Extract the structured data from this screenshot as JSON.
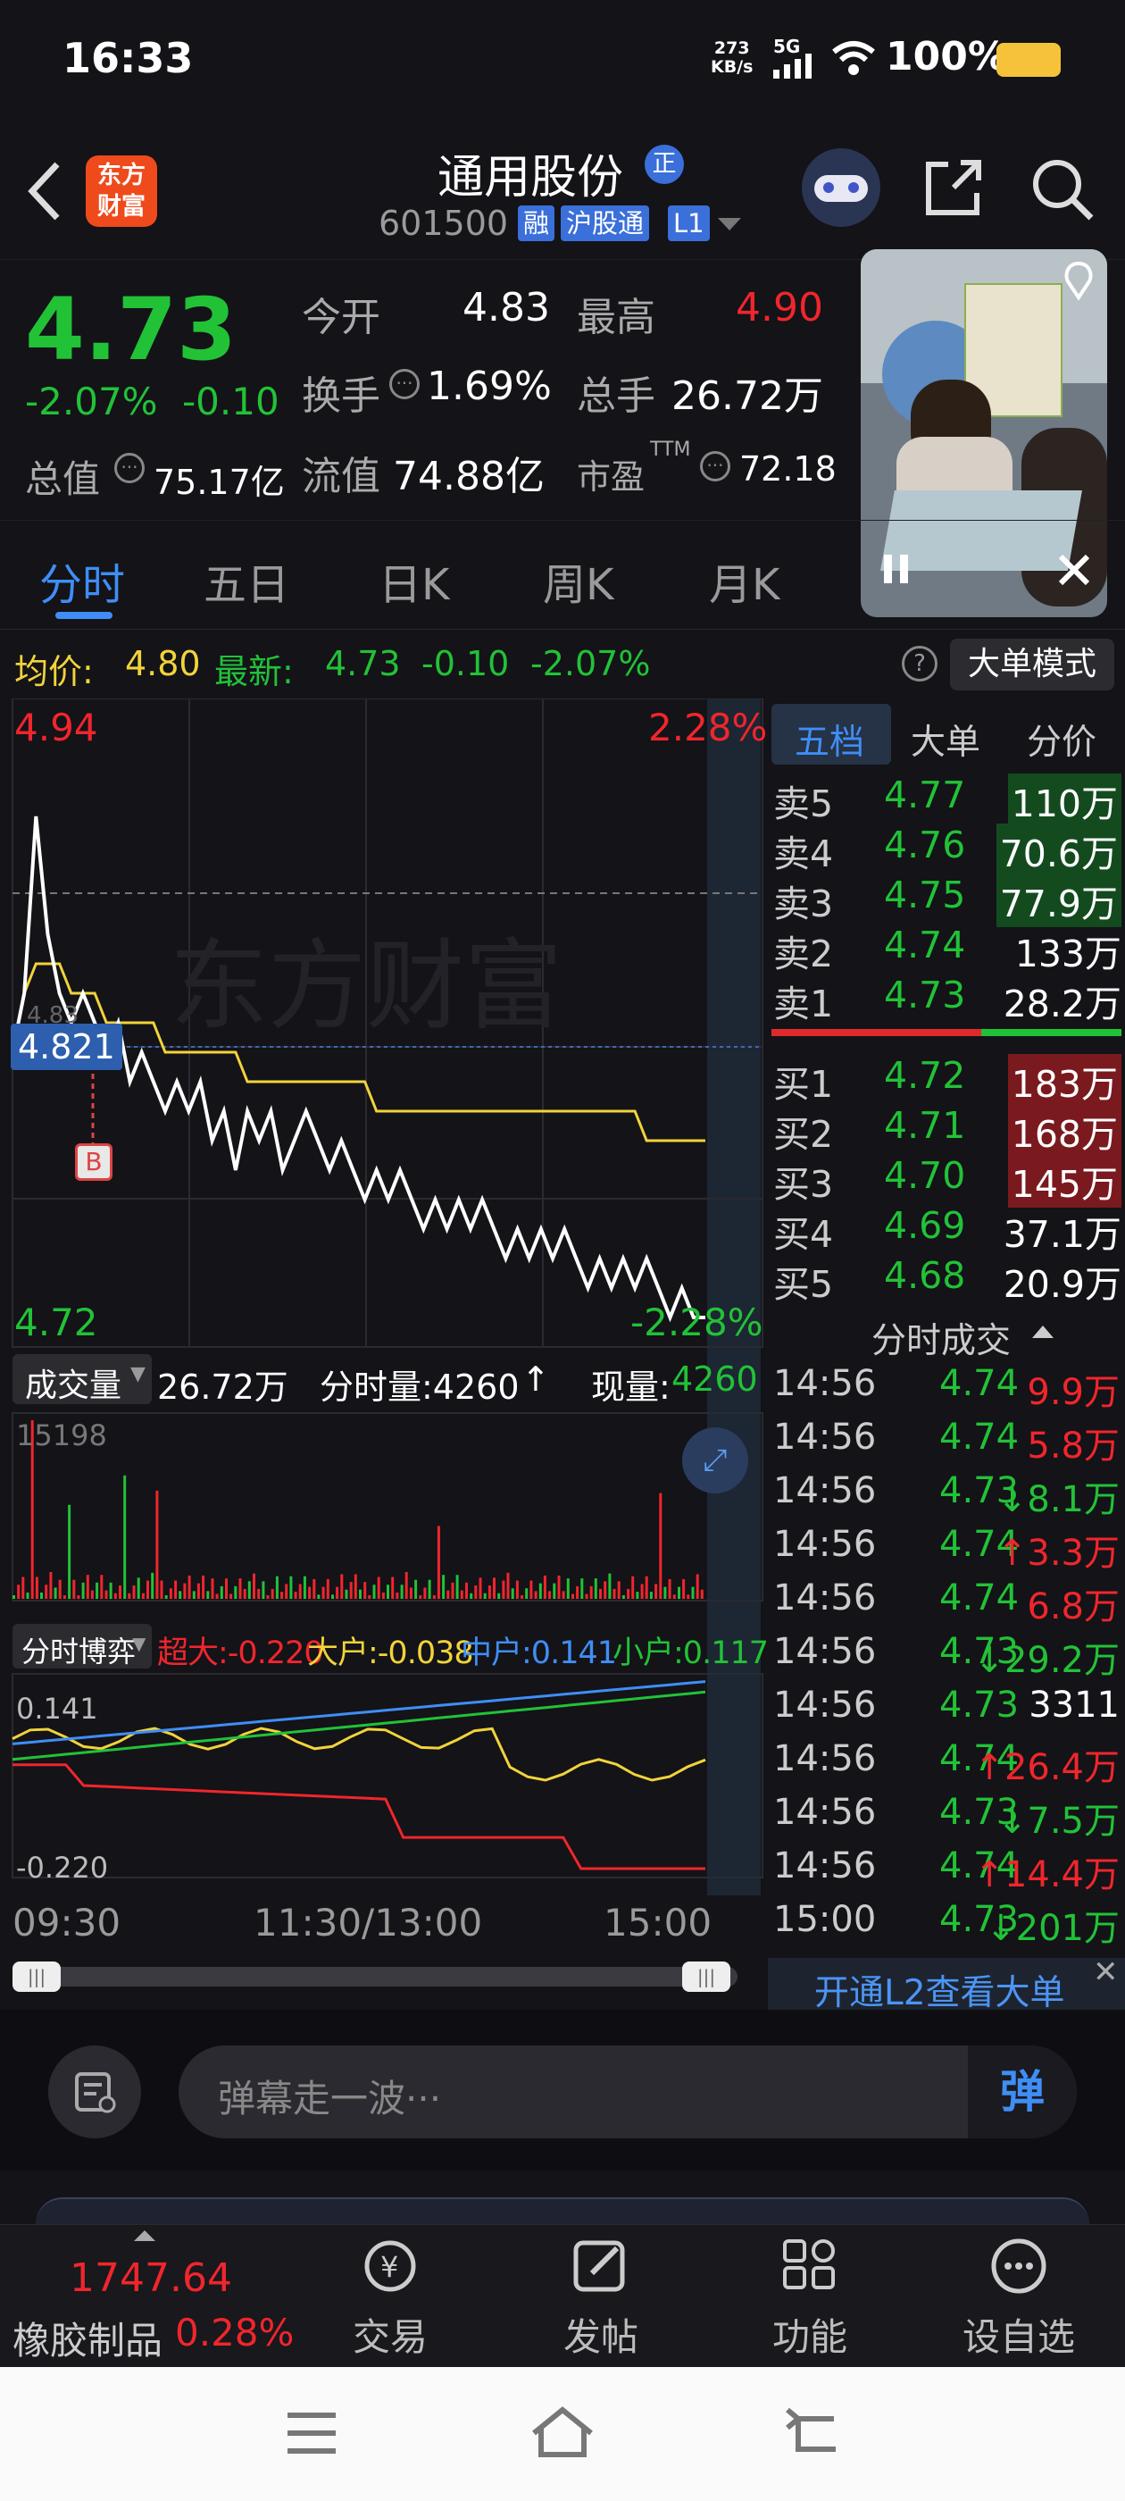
{
  "status": {
    "time": "16:33",
    "net_speed_top": "273",
    "net_speed_bottom": "KB/s",
    "network": "5G",
    "battery": "100%"
  },
  "header": {
    "logo_top": "东方",
    "logo_bottom": "财富",
    "stock_name": "通用股份",
    "badge_zheng": "正",
    "code": "601500",
    "tag_rong": "融",
    "tag_hgt": "沪股通",
    "tag_l1": "L1"
  },
  "quote": {
    "price": "4.73",
    "change_pct": "-2.07%",
    "change": "-0.10",
    "open_label": "今开",
    "open": "4.83",
    "high_label": "最高",
    "high": "4.90",
    "turnover_label": "换手",
    "turnover": "1.69%",
    "volume_label": "总手",
    "volume": "26.72万",
    "mktcap_label": "总值",
    "mktcap": "75.17亿",
    "float_label": "流值",
    "float_cap": "74.88亿",
    "pe_label": "市盈",
    "pe_sup": "TTM",
    "pe": "72.18"
  },
  "tabs": [
    "分时",
    "五日",
    "日K",
    "周K",
    "月K"
  ],
  "avg_row": {
    "avg_label": "均价:",
    "avg": "4.80",
    "latest_label": "最新:",
    "latest": "4.73",
    "chg": "-0.10",
    "pct": "-2.07%",
    "mode_button": "大单模式"
  },
  "chart": {
    "top_price": "4.94",
    "top_pct": "2.28%",
    "bottom_price": "4.72",
    "bottom_pct": "-2.28%",
    "cursor_price": "4.821",
    "marker": "B",
    "watermark": "东方财富",
    "mid_label": "4.83"
  },
  "volume_bar": {
    "label": "成交量",
    "total": "26.72万",
    "fen_label": "分时量:4260",
    "arrow": "↑",
    "now_label": "现量:",
    "now": "4260",
    "max": "15198"
  },
  "game": {
    "label": "分时博弈",
    "super_label": "超大:",
    "super": "-0.220",
    "big_label": "大户:",
    "big": "-0.038",
    "mid_label": "中户:",
    "mid": "0.141",
    "small_label": "小户:",
    "small": "0.117",
    "max": "0.141",
    "min": "-0.220"
  },
  "time_axis": [
    "09:30",
    "11:30/13:00",
    "15:00"
  ],
  "book": {
    "tabs": [
      "五档",
      "大单",
      "分价"
    ],
    "asks": [
      {
        "label": "卖5",
        "price": "4.77",
        "vol": "110万"
      },
      {
        "label": "卖4",
        "price": "4.76",
        "vol": "70.6万"
      },
      {
        "label": "卖3",
        "price": "4.75",
        "vol": "77.9万"
      },
      {
        "label": "卖2",
        "price": "4.74",
        "vol": "133万"
      },
      {
        "label": "卖1",
        "price": "4.73",
        "vol": "28.2万"
      }
    ],
    "bids": [
      {
        "label": "买1",
        "price": "4.72",
        "vol": "183万"
      },
      {
        "label": "买2",
        "price": "4.71",
        "vol": "168万"
      },
      {
        "label": "买3",
        "price": "4.70",
        "vol": "145万"
      },
      {
        "label": "买4",
        "price": "4.69",
        "vol": "37.1万"
      },
      {
        "label": "买5",
        "price": "4.68",
        "vol": "20.9万"
      }
    ],
    "trades_title": "分时成交",
    "trades": [
      {
        "t": "14:56",
        "p": "4.74",
        "v": "9.9万",
        "c": "red",
        "a": ""
      },
      {
        "t": "14:56",
        "p": "4.74",
        "v": "5.8万",
        "c": "red",
        "a": ""
      },
      {
        "t": "14:56",
        "p": "4.73",
        "v": "8.1万",
        "c": "green",
        "a": "↓"
      },
      {
        "t": "14:56",
        "p": "4.74",
        "v": "3.3万",
        "c": "red",
        "a": "↑"
      },
      {
        "t": "14:56",
        "p": "4.74",
        "v": "6.8万",
        "c": "red",
        "a": ""
      },
      {
        "t": "14:56",
        "p": "4.73",
        "v": "29.2万",
        "c": "green",
        "a": "↓"
      },
      {
        "t": "14:56",
        "p": "4.73",
        "v": "3311",
        "c": "white",
        "a": ""
      },
      {
        "t": "14:56",
        "p": "4.74",
        "v": "26.4万",
        "c": "red",
        "a": "↑"
      },
      {
        "t": "14:56",
        "p": "4.73",
        "v": "7.5万",
        "c": "green",
        "a": "↓"
      },
      {
        "t": "14:56",
        "p": "4.74",
        "v": "14.4万",
        "c": "red",
        "a": "↑"
      },
      {
        "t": "15:00",
        "p": "4.73",
        "v": "201万",
        "c": "green",
        "a": "↓"
      }
    ],
    "l2_link": "开通L2查看大单"
  },
  "comment": {
    "placeholder": "弹幕走一波···",
    "send": "弹"
  },
  "bottom": {
    "index_value": "1747.64",
    "index_name": "橡胶制品",
    "index_pct": "0.28%",
    "items": [
      "交易",
      "发帖",
      "功能",
      "设自选"
    ]
  },
  "colors": {
    "up": "#f0262c",
    "down": "#22c237",
    "avg": "#f2d33a",
    "accent": "#3f8ef5"
  }
}
